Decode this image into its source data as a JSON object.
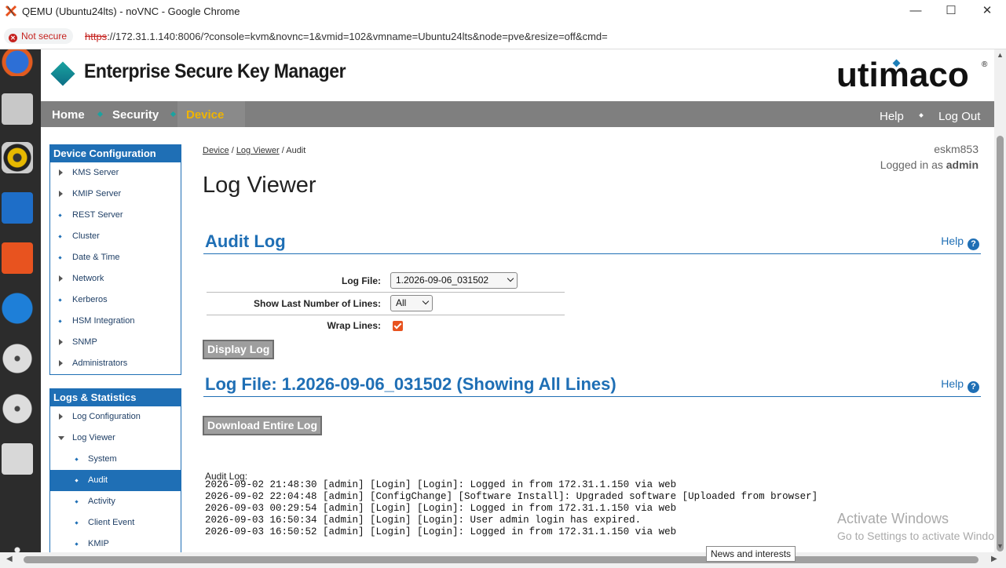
{
  "window": {
    "title": "QEMU (Ubuntu24lts) - noVNC - Google Chrome",
    "minimize": "—",
    "maximize": "☐",
    "close": "✕"
  },
  "addressbar": {
    "security_label": "Not secure",
    "url_scheme": "https",
    "url_rest": "://172.31.1.140:8006/?console=kvm&novnc=1&vmid=102&vmname=Ubuntu24lts&node=pve&resize=off&cmd="
  },
  "app": {
    "title": "Enterprise Secure Key Manager",
    "brand": "utimaco",
    "brand_reg": "®"
  },
  "nav": {
    "home": "Home",
    "security": "Security",
    "device": "Device",
    "help": "Help",
    "logout": "Log Out",
    "active_color": "#f0b400"
  },
  "sidebar": {
    "device_config_title": "Device Configuration",
    "device_config_items": [
      {
        "label": "KMS Server",
        "marker": "triangle"
      },
      {
        "label": "KMIP Server",
        "marker": "triangle"
      },
      {
        "label": "REST Server",
        "marker": "bullet"
      },
      {
        "label": "Cluster",
        "marker": "bullet"
      },
      {
        "label": "Date & Time",
        "marker": "bullet"
      },
      {
        "label": "Network",
        "marker": "triangle"
      },
      {
        "label": "Kerberos",
        "marker": "bullet"
      },
      {
        "label": "HSM Integration",
        "marker": "bullet"
      },
      {
        "label": "SNMP",
        "marker": "triangle"
      },
      {
        "label": "Administrators",
        "marker": "triangle"
      }
    ],
    "logs_title": "Logs & Statistics",
    "logs_items": [
      {
        "label": "Log Configuration",
        "marker": "triangle"
      },
      {
        "label": "Log Viewer",
        "marker": "triangle-down"
      },
      {
        "label": "System",
        "marker": "bullet",
        "sub": true
      },
      {
        "label": "Audit",
        "marker": "bullet",
        "sub": true,
        "selected": true
      },
      {
        "label": "Activity",
        "marker": "bullet",
        "sub": true
      },
      {
        "label": "Client Event",
        "marker": "bullet",
        "sub": true
      },
      {
        "label": "KMIP",
        "marker": "bullet",
        "sub": true
      }
    ]
  },
  "breadcrumb": {
    "device": "Device",
    "log_viewer": "Log Viewer",
    "current": "Audit",
    "sep": "/"
  },
  "user": {
    "host": "eskm853",
    "logged_in_prefix": "Logged in as ",
    "username": "admin"
  },
  "page": {
    "title": "Log Viewer",
    "audit_section_title": "Audit Log",
    "help_label": "Help",
    "help_q": "?",
    "log_file_label": "Log File:",
    "log_file_value": "1.2026-09-06_031502",
    "show_lines_label": "Show Last Number of Lines:",
    "show_lines_value": "All",
    "wrap_label": "Wrap Lines:",
    "wrap_checked": true,
    "display_button": "Display Log",
    "logfile_section_title": "Log File: 1.2026-09-06_031502 (Showing All Lines)",
    "download_button": "Download Entire Log",
    "log_heading": "Audit Log:",
    "log_lines": [
      "2026-09-02 21:48:30 [admin] [Login] [Login]: Logged in from 172.31.1.150 via web",
      "2026-09-02 22:04:48 [admin] [ConfigChange] [Software Install]: Upgraded software [Uploaded from browser]",
      "2026-09-03 00:29:54 [admin] [Login] [Login]: Logged in from 172.31.1.150 via web",
      "2026-09-03 16:50:34 [admin] [Login] [Login]: User admin login has expired.",
      "2026-09-03 16:50:52 [admin] [Login] [Login]: Logged in from 172.31.1.150 via web"
    ]
  },
  "overlay": {
    "activate_title": "Activate Windows",
    "activate_sub": "Go to Settings to activate Windo",
    "tooltip": "News and interests"
  }
}
